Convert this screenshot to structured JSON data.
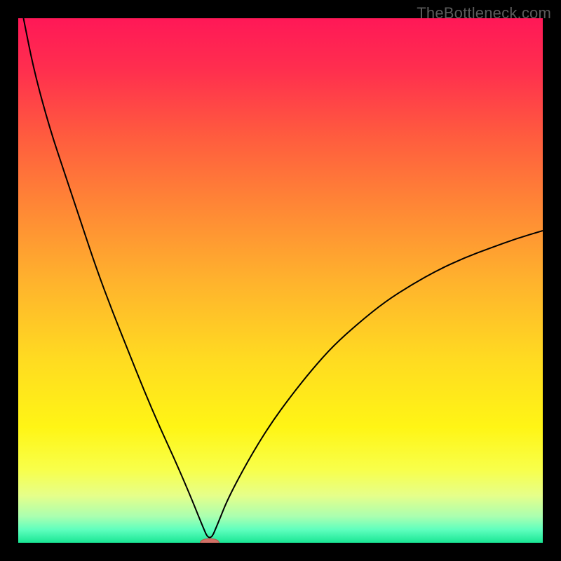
{
  "watermark": "TheBottleneck.com",
  "colors": {
    "frame": "#000000",
    "curve": "#000000",
    "gradient_stops": [
      {
        "offset": 0,
        "color": "#ff1857"
      },
      {
        "offset": 0.1,
        "color": "#ff2f4e"
      },
      {
        "offset": 0.22,
        "color": "#ff5a3f"
      },
      {
        "offset": 0.35,
        "color": "#ff8436"
      },
      {
        "offset": 0.5,
        "color": "#ffb22d"
      },
      {
        "offset": 0.65,
        "color": "#ffdb21"
      },
      {
        "offset": 0.78,
        "color": "#fff515"
      },
      {
        "offset": 0.86,
        "color": "#f8ff4a"
      },
      {
        "offset": 0.91,
        "color": "#e6ff8a"
      },
      {
        "offset": 0.95,
        "color": "#aaffb0"
      },
      {
        "offset": 0.975,
        "color": "#5fffbe"
      },
      {
        "offset": 1.0,
        "color": "#19e694"
      }
    ],
    "marker_fill": "#d27066",
    "marker_stroke": "#b6584e"
  },
  "chart_data": {
    "type": "line",
    "title": "",
    "xlabel": "",
    "ylabel": "",
    "xlim": [
      0,
      100
    ],
    "ylim": [
      0,
      100
    ],
    "grid": false,
    "legend": false,
    "description": "V-shaped bottleneck curve over a fixed rainbow gradient. Minimum y=0 at x≈36.5; left branch reaches 100 at x≈1, right branch reaches ~60 at x=100.",
    "series": [
      {
        "name": "bottleneck-curve",
        "x": [
          1,
          3,
          6,
          9,
          12,
          15,
          18,
          21,
          24,
          27,
          30,
          33,
          34.8,
          36.5,
          38.2,
          40,
          44,
          48,
          52,
          56,
          60,
          65,
          70,
          75,
          80,
          85,
          90,
          95,
          100
        ],
        "y": [
          100,
          90,
          79,
          70,
          61,
          52,
          44,
          36.5,
          29,
          22,
          15.5,
          8.5,
          4,
          0,
          4,
          8.5,
          16,
          22.5,
          28,
          33,
          37.5,
          42,
          46,
          49.2,
          52,
          54.3,
          56.2,
          58,
          59.5
        ]
      }
    ],
    "marker": {
      "x": 36.5,
      "y": 0,
      "rx": 1.8,
      "ry": 0.8
    }
  }
}
